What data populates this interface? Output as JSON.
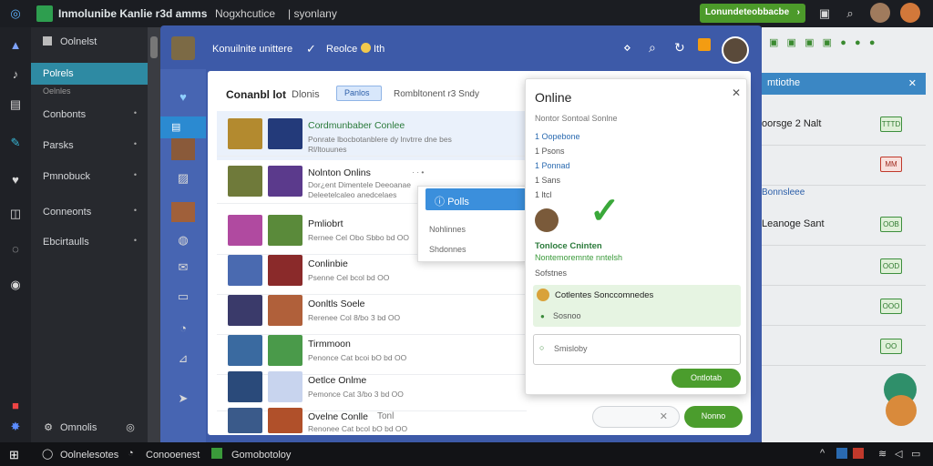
{
  "topbar": {
    "title": "Inmolunibe Kanlie r3d amms",
    "item2": "Nogxhcutice",
    "item3": "| syonlany",
    "green_button": "Lonundeteobbacbe"
  },
  "sidebar": {
    "header": "Oolnelst",
    "items": [
      {
        "label": "Polrels",
        "sub": "Oelnles"
      },
      {
        "label": "Conbonts"
      },
      {
        "label": "Parsks"
      },
      {
        "label": "Pmnobuck"
      },
      {
        "label": "Conneonts"
      },
      {
        "label": "Ebcirtaulls"
      }
    ],
    "footer": "Omnolis"
  },
  "window": {
    "title": "Konuilnite unittere",
    "status1": "Reolce",
    "status2": "Ith"
  },
  "toolbar": {
    "heading": "Conanbl lot",
    "filter1": "Dlonis",
    "pill": "Panlos",
    "filter2": "Rombltonent r3 Sndy"
  },
  "rows": [
    {
      "title": "Cordmunbaber Conlee",
      "sub1": "Ponrate lbocbotanblere dy lnvtrre dne bes",
      "sub2": "Rl/ltouunes"
    },
    {
      "title": "Nolnton Onlins",
      "badge": "· · •",
      "sub1": "Dor¿ent Dimentele Deeoanae",
      "sub2": "Deleetelcaleo anedcelaes"
    },
    {
      "title": "Pmliobrt",
      "sub1": "Rernee Cel Obo Sbbo bd OO"
    },
    {
      "title": "Conlinbie",
      "sub1": "Psenne Cel bcol bd OO"
    },
    {
      "title": "Oonltls Soele",
      "sub1": "Rerenee Col 8/bo 3 bd OO"
    },
    {
      "title": "Tirmmoon",
      "sub1": "Penonce Cat bcoi bO bd OO"
    },
    {
      "title": "Oetlce Onlme",
      "sub1": "Pemonce Cat 3/bo 3 bd OO"
    },
    {
      "title": "Ovelne Conlle",
      "badge": "Tonl",
      "sub1": "Renonee Cat bcol bO bd OO"
    }
  ],
  "dropdown": {
    "active": "Polls",
    "item2": "Nohlinnes",
    "item3": "Shdonnes"
  },
  "panel": {
    "title": "Online",
    "subtitle": "Nontor Sontoal Sonlne",
    "lines": [
      "1 Oopebone",
      "1 Psons",
      "1 Ponnad",
      "1 Sans",
      "1 ltcl"
    ],
    "green_title": "Tonloce Cninten",
    "green_sub": "Nontemoremnte nntelsh",
    "label": "Sofstnes",
    "box_title": "Cotlentes Sonccomnedes",
    "box_line": "Sosnoo",
    "input": "Smisloby",
    "action": "Ontlotab"
  },
  "bottom_actions": {
    "action": "Nonno"
  },
  "rightpane": {
    "header": "mtiothe",
    "rows": [
      {
        "label": "oorsge 2 Nalt",
        "badge": "TTTD"
      },
      {
        "label": "",
        "badge": "MM"
      },
      {
        "label": "Bonnsleee",
        "badge": ""
      },
      {
        "label": "Leanoge Sant",
        "badge": "OOB"
      },
      {
        "label": "",
        "badge": "OOD"
      },
      {
        "label": "",
        "badge": "OOO"
      },
      {
        "label": "",
        "badge": "OO"
      }
    ]
  },
  "taskbar": {
    "item1": "Oolnelesotes",
    "item2": "Conooenest",
    "item3": "Gomobotoloy"
  }
}
